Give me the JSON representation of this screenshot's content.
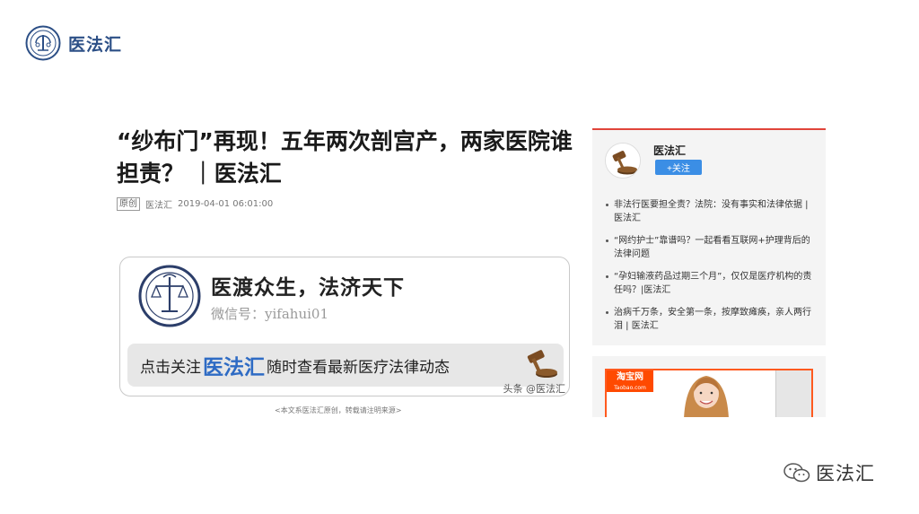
{
  "brand": {
    "name": "医法汇",
    "logo_icon": "gavel-seal-logo-icon"
  },
  "article": {
    "title": "“纱布门”再现！五年两次剖宫产，两家医院谁担责？ ｜医法汇",
    "meta": {
      "badge": "原创",
      "author": "医法汇",
      "datetime": "2019-04-01 06:01:00"
    },
    "promo": {
      "slogan": "医渡众生，法济天下",
      "wechat_label": "微信号：",
      "wechat_id": "yifahui01",
      "bar_prefix": "点击关注",
      "bar_highlight": "医法汇",
      "bar_suffix": "随时查看最新医疗法律动态",
      "watermark": "头条 @医法汇"
    },
    "note": "<本文系医法汇原创，转载请注明来源>"
  },
  "sidebar": {
    "account_name": "医法汇",
    "follow_label": "+关注",
    "related": [
      "非法行医要担全责？法院：没有事实和法律依据 | 医法汇",
      "“网约护士”靠谱吗？一起看看互联网+护理背后的法律问题",
      "“孕妇输液药品过期三个月”，仅仅是医疗机构的责任吗？|医法汇",
      "治病千万条，安全第一条，按摩致瘫痪，亲人两行泪 | 医法汇"
    ],
    "accent_color": "#e0443a"
  },
  "ad": {
    "logo_text": "淘宝网",
    "logo_sub": "Taobao.com"
  },
  "wechat_watermark": {
    "icon": "wechat-icon",
    "text": "医法汇"
  },
  "colors": {
    "brand_blue": "#2c4f86",
    "highlight_blue": "#2e6bc4",
    "follow_blue": "#3b8ee5",
    "taobao_orange": "#ff4a00"
  }
}
